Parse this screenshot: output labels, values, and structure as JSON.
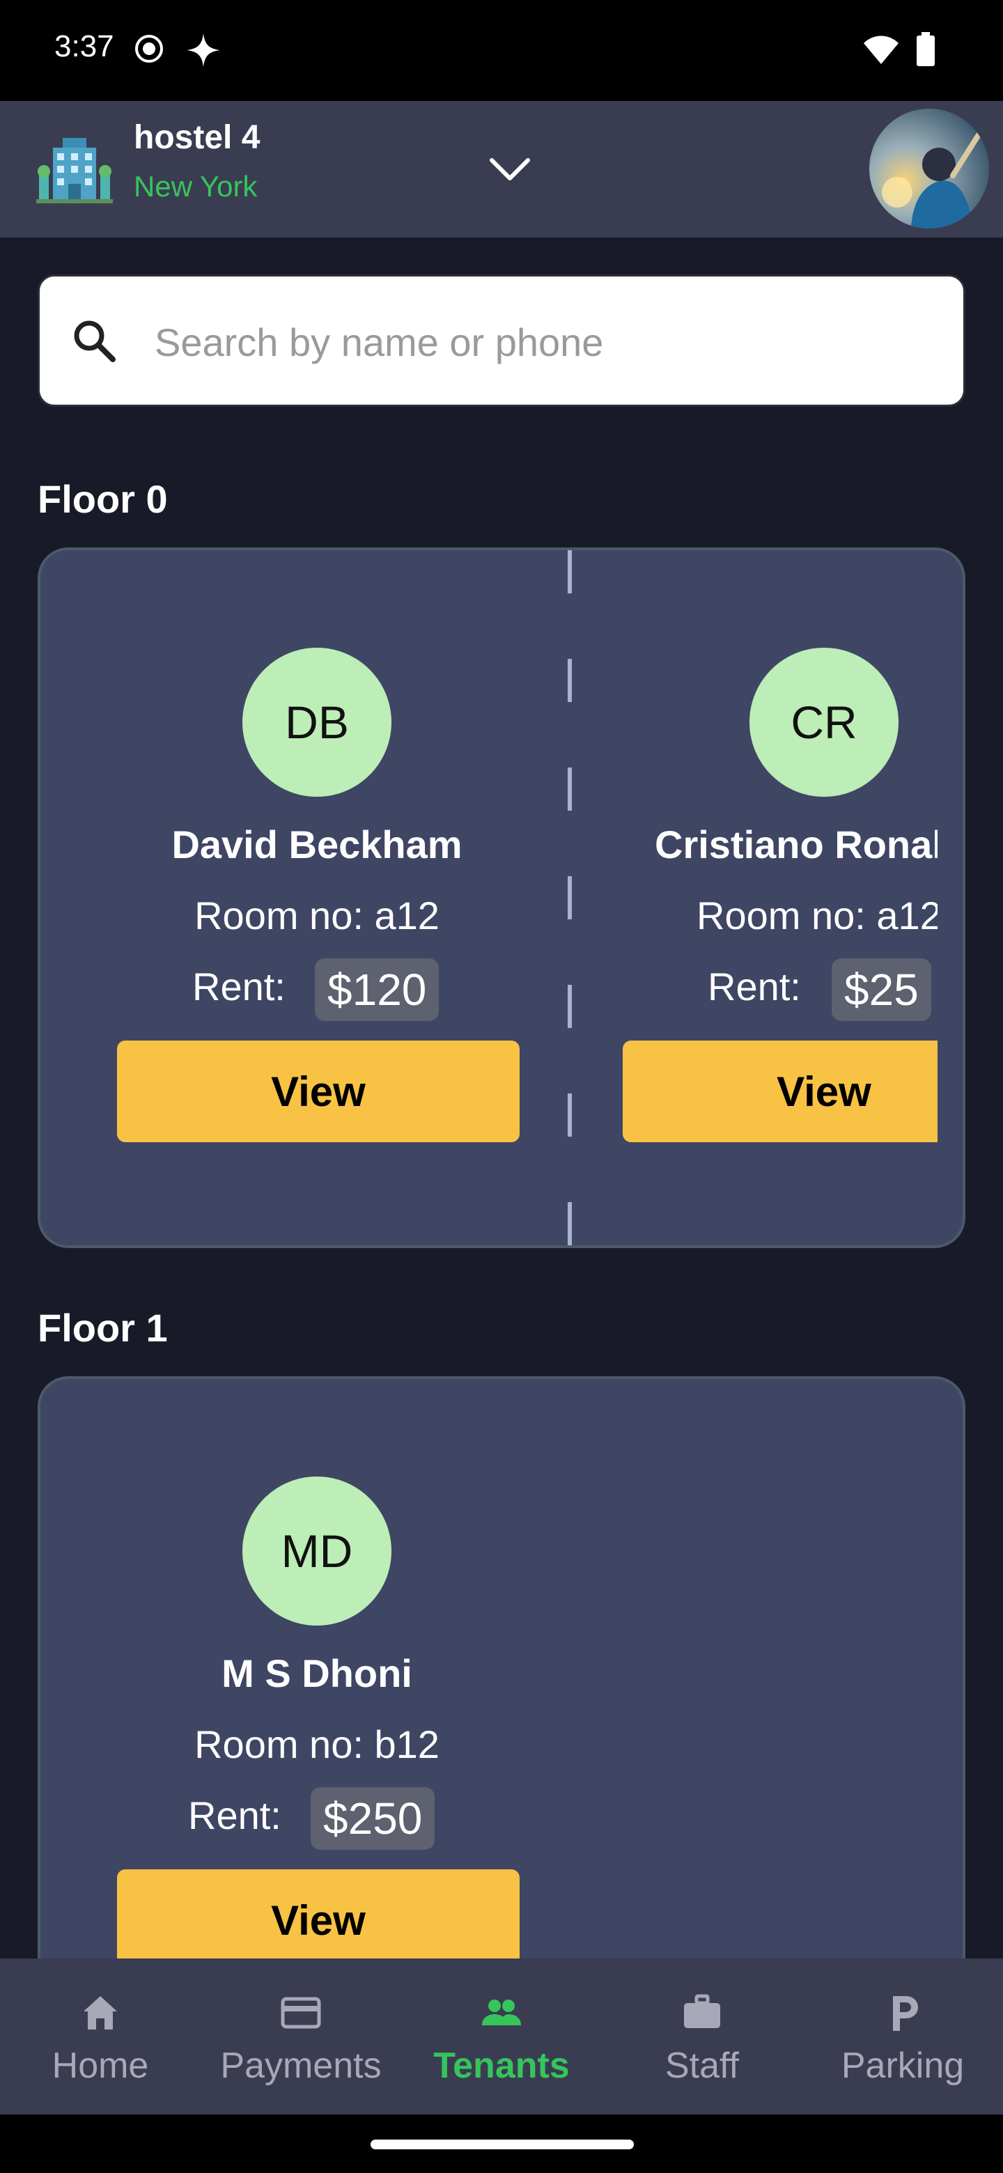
{
  "status_bar": {
    "time": "3:37"
  },
  "header": {
    "hostel_name": "hostel 4",
    "city": "New York"
  },
  "search": {
    "placeholder": "Search by name or phone"
  },
  "floors": [
    {
      "title": "Floor 0",
      "tenants": [
        {
          "initials": "DB",
          "name": "David Beckham",
          "room": "Room no: a12",
          "rent_label": "Rent:",
          "rent": "$120",
          "view_label": "View"
        },
        {
          "initials": "CR",
          "name": "Cristiano Ronal",
          "room": "Room no: a12",
          "rent_label": "Rent:",
          "rent": "$25",
          "view_label": "View"
        }
      ]
    },
    {
      "title": "Floor 1",
      "tenants": [
        {
          "initials": "MD",
          "name": "M S Dhoni",
          "room": "Room no: b12",
          "rent_label": "Rent:",
          "rent": "$250",
          "view_label": "View"
        }
      ]
    }
  ],
  "nav": {
    "items": [
      {
        "label": "Home",
        "icon": "home-icon"
      },
      {
        "label": "Payments",
        "icon": "card-icon"
      },
      {
        "label": "Tenants",
        "icon": "people-icon"
      },
      {
        "label": "Staff",
        "icon": "briefcase-icon"
      },
      {
        "label": "Parking",
        "icon": "parking-icon"
      }
    ],
    "active": "Tenants"
  },
  "colors": {
    "accent": "#35c55b",
    "button": "#f8c244",
    "card": "#3f4664",
    "avatar_circle": "#bdeeb7"
  }
}
